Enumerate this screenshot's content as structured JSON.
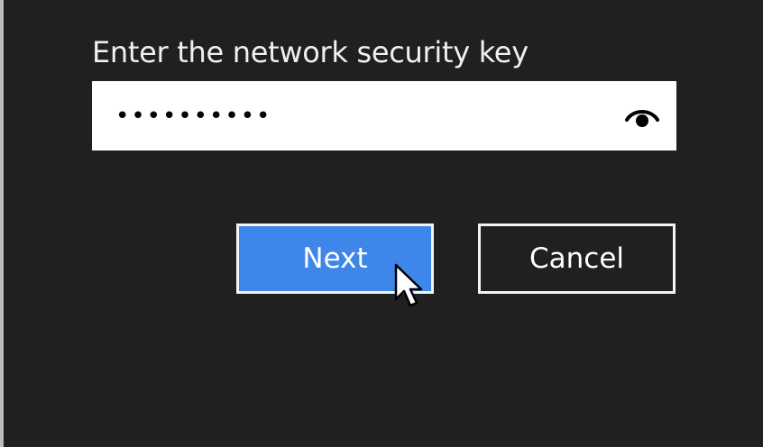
{
  "dialog": {
    "prompt": "Enter the network security key"
  },
  "key_field": {
    "masked_value": "••••••••••",
    "reveal_icon": "eye-icon"
  },
  "buttons": {
    "next_label": "Next",
    "cancel_label": "Cancel"
  },
  "colors": {
    "background": "#202020",
    "accent": "#3f86ea",
    "text": "#f0f0f0"
  },
  "cursor": "mouse-pointer-icon"
}
